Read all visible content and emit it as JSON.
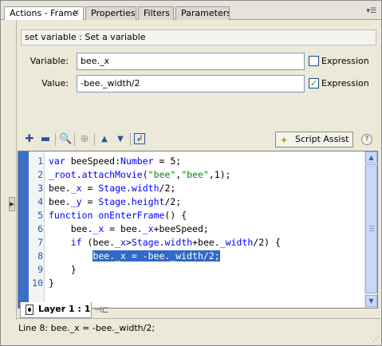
{
  "tabs": [
    {
      "label": "Actions - Frame",
      "active": true,
      "close": "✕"
    },
    {
      "label": "Properties",
      "active": false
    },
    {
      "label": "Filters",
      "active": false
    },
    {
      "label": "Parameters",
      "active": false
    }
  ],
  "panel_menu_icon": "panel-options-icon",
  "description": "set variable : Set a variable",
  "variable": {
    "label": "Variable:",
    "value": "bee._x",
    "expression_label": "Expression",
    "expression_checked": false
  },
  "value": {
    "label": "Value:",
    "value": "-bee._width/2",
    "expression_label": "Expression",
    "expression_checked": true
  },
  "toolbar": {
    "icons": [
      "add-statement-icon",
      "delete-statement-icon",
      "find-icon",
      "target-icon",
      "move-up-icon",
      "move-down-icon",
      "debug-options-icon"
    ],
    "script_assist_label": "Script Assist",
    "help_icon": "?"
  },
  "code": {
    "lines": [
      {
        "num": "1",
        "parts": [
          [
            "kw",
            "var"
          ],
          [
            "plain",
            " beeSpeed:"
          ],
          [
            "kw",
            "Number"
          ],
          [
            "plain",
            " = 5;"
          ]
        ]
      },
      {
        "num": "2",
        "parts": [
          [
            "kw",
            "_root"
          ],
          [
            "plain",
            "."
          ],
          [
            "kw",
            "attachMovie"
          ],
          [
            "plain",
            "("
          ],
          [
            "str",
            "\"bee\""
          ],
          [
            "plain",
            ","
          ],
          [
            "str",
            "\"bee\""
          ],
          [
            "plain",
            ",1);"
          ]
        ]
      },
      {
        "num": "3",
        "parts": [
          [
            "plain",
            "bee."
          ],
          [
            "kw",
            "_x"
          ],
          [
            "plain",
            " = "
          ],
          [
            "kw",
            "Stage"
          ],
          [
            "plain",
            "."
          ],
          [
            "kw",
            "width"
          ],
          [
            "plain",
            "/2;"
          ]
        ]
      },
      {
        "num": "4",
        "parts": [
          [
            "plain",
            "bee."
          ],
          [
            "kw",
            "_y"
          ],
          [
            "plain",
            " = "
          ],
          [
            "kw",
            "Stage"
          ],
          [
            "plain",
            "."
          ],
          [
            "kw",
            "height"
          ],
          [
            "plain",
            "/2;"
          ]
        ]
      },
      {
        "num": "5",
        "parts": [
          [
            "kw",
            "function"
          ],
          [
            "plain",
            " "
          ],
          [
            "kw",
            "onEnterFrame"
          ],
          [
            "plain",
            "() {"
          ]
        ]
      },
      {
        "num": "6",
        "parts": [
          [
            "plain",
            "    bee."
          ],
          [
            "kw",
            "_x"
          ],
          [
            "plain",
            " = bee."
          ],
          [
            "kw",
            "_x"
          ],
          [
            "plain",
            "+beeSpeed;"
          ]
        ]
      },
      {
        "num": "7",
        "parts": [
          [
            "plain",
            "    "
          ],
          [
            "kw",
            "if"
          ],
          [
            "plain",
            " (bee."
          ],
          [
            "kw",
            "_x"
          ],
          [
            "plain",
            ">"
          ],
          [
            "kw",
            "Stage"
          ],
          [
            "plain",
            "."
          ],
          [
            "kw",
            "width"
          ],
          [
            "plain",
            "+bee."
          ],
          [
            "kw",
            "_width"
          ],
          [
            "plain",
            "/2) {"
          ]
        ]
      },
      {
        "num": "8",
        "parts": [
          [
            "plain",
            "        "
          ],
          [
            "sel",
            "bee._x = -bee._width/2;"
          ]
        ]
      },
      {
        "num": "9",
        "parts": [
          [
            "plain",
            "    }"
          ]
        ]
      },
      {
        "num": "10",
        "parts": [
          [
            "plain",
            "}"
          ]
        ]
      }
    ],
    "selected_line": 8
  },
  "layer_tab": {
    "label": "Layer 1 : 1"
  },
  "status": "Line 8: bee._x = -bee._width/2;"
}
